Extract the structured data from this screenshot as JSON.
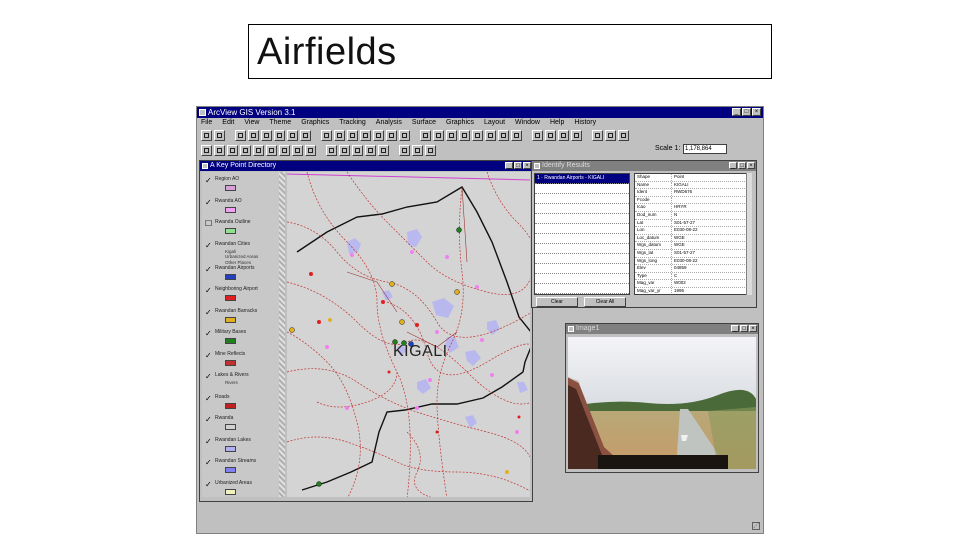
{
  "slide": {
    "title": "Airfields"
  },
  "app": {
    "title": "ArcView GIS Version 3.1",
    "menu": [
      "File",
      "Edit",
      "View",
      "Theme",
      "Graphics",
      "Tracking",
      "Analysis",
      "Surface",
      "Graphics",
      "Layout",
      "Window",
      "Help",
      "History"
    ],
    "scale_label": "Scale 1:",
    "scale_value": "1,178,864"
  },
  "view_window": {
    "title": "A Key Point Directory",
    "map_label": "KIGALI",
    "layers": [
      {
        "name": "Region AO",
        "checked": true,
        "swatch": "#d8a0d8"
      },
      {
        "name": "Rwanda AO",
        "checked": true,
        "swatch": "#f0a0f0"
      },
      {
        "name": "Rwanda Outline",
        "checked": false,
        "swatch": "#90e090"
      },
      {
        "name": "Rwandan Cities",
        "checked": true,
        "subs": [
          "Kigali",
          "Urbanized Areas",
          "Other Places"
        ]
      },
      {
        "name": "Rwandan Airports",
        "checked": true,
        "swatch": "#2040c0"
      },
      {
        "name": "Neighboring Airport",
        "checked": true,
        "swatch": "#e02020"
      },
      {
        "name": "Rwandan Barracks",
        "checked": true,
        "swatch": "#e0b020"
      },
      {
        "name": "Military Bases",
        "checked": true,
        "swatch": "#208020"
      },
      {
        "name": "Mine Reflects",
        "checked": true,
        "swatch": "#c03030"
      },
      {
        "name": "Lakes & Rivers",
        "checked": true,
        "subs": [
          "Rivers"
        ]
      },
      {
        "name": "Roads",
        "checked": true,
        "swatch": "#c02020"
      },
      {
        "name": "Rwanda",
        "checked": true,
        "swatch": "#d0d0d0"
      },
      {
        "name": "Rwandan Lakes",
        "checked": true,
        "swatch": "#b0b0f0"
      },
      {
        "name": "Rwandan Streams",
        "checked": true,
        "swatch": "#8080f0"
      },
      {
        "name": "Urbanized Areas",
        "checked": true,
        "swatch": "#f0f0c0"
      }
    ]
  },
  "identify_window": {
    "title": "Identify Results",
    "selected": "1 · Rwandan Airports - KIGALI",
    "attributes": [
      {
        "k": "Shape",
        "v": "Point"
      },
      {
        "k": "Name",
        "v": "KIGALI"
      },
      {
        "k": "Ident",
        "v": "RWD676"
      },
      {
        "k": "Fcode",
        "v": ""
      },
      {
        "k": "Icao",
        "v": "HRYR"
      },
      {
        "k": "Dod_num",
        "v": "N"
      },
      {
        "k": "Lat",
        "v": "S01-57-27"
      },
      {
        "k": "Lon",
        "v": "E030-08-22"
      },
      {
        "k": "Loc_datum",
        "v": "WGE"
      },
      {
        "k": "Wgs_datum",
        "v": "WGE"
      },
      {
        "k": "Wgs_lat",
        "v": "S01-57-27"
      },
      {
        "k": "Wgs_long",
        "v": "E030-08-22"
      },
      {
        "k": "Elev",
        "v": "04859"
      },
      {
        "k": "Type",
        "v": "C"
      },
      {
        "k": "Mag_var",
        "v": "W002"
      },
      {
        "k": "Mag_var_yr",
        "v": "1995"
      }
    ],
    "btn_clear": "Clear",
    "btn_clear_all": "Clear All"
  },
  "image_window": {
    "title": "Image1"
  },
  "colors": {
    "titlebar": "#000080",
    "chrome": "#c0c0c0",
    "map_bg": "#d4d4d4",
    "roads": "#c02020",
    "border": "#111111",
    "lakes": "#b0b0f0"
  }
}
